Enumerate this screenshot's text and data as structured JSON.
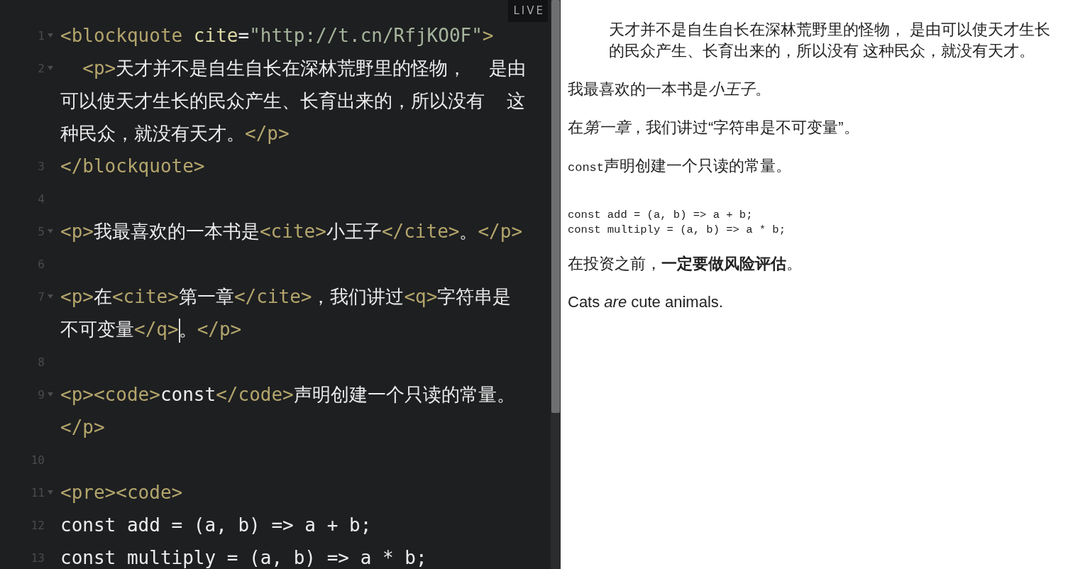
{
  "editor": {
    "live_label": "LIVE",
    "lines": [
      {
        "number": "1",
        "foldable": true,
        "tokens": [
          {
            "kind": "tag",
            "text": "<blockquote"
          },
          {
            "kind": "attr",
            "text": " cite"
          },
          {
            "kind": "text",
            "text": "="
          },
          {
            "kind": "string",
            "text": "\"http://t.cn/RfjKO0F\""
          },
          {
            "kind": "tag",
            "text": ">"
          }
        ]
      },
      {
        "number": "2",
        "foldable": true,
        "tokens": [
          {
            "kind": "tag",
            "text": "  <p>"
          },
          {
            "kind": "text",
            "text": "天才并不是自生自长在深林荒野里的怪物，  是由可以使天才生长的民众产生、长育出来的，所以没有  这种民众，就没有天才。"
          },
          {
            "kind": "tag",
            "text": "</p>"
          }
        ]
      },
      {
        "number": "3",
        "foldable": false,
        "tokens": [
          {
            "kind": "tag",
            "text": "</blockquote>"
          }
        ]
      },
      {
        "number": "4",
        "foldable": false
      },
      {
        "number": "5",
        "foldable": true,
        "tokens": [
          {
            "kind": "tag",
            "text": "<p>"
          },
          {
            "kind": "text",
            "text": "我最喜欢的一本书是"
          },
          {
            "kind": "tag",
            "text": "<cite>"
          },
          {
            "kind": "text",
            "text": "小王子"
          },
          {
            "kind": "tag",
            "text": "</cite>"
          },
          {
            "kind": "text",
            "text": "。"
          },
          {
            "kind": "tag",
            "text": "</p>"
          }
        ]
      },
      {
        "number": "6",
        "foldable": false
      },
      {
        "number": "7",
        "foldable": true,
        "tokens": [
          {
            "kind": "tag",
            "text": "<p>"
          },
          {
            "kind": "text",
            "text": "在"
          },
          {
            "kind": "tag",
            "text": "<cite>"
          },
          {
            "kind": "text",
            "text": "第一章"
          },
          {
            "kind": "tag",
            "text": "</cite>"
          },
          {
            "kind": "text",
            "text": "，我们讲过"
          },
          {
            "kind": "tag",
            "text": "<q>"
          },
          {
            "kind": "text",
            "text": "字符串是不可变量"
          },
          {
            "kind": "tag",
            "text": "</q>",
            "cursor": true
          },
          {
            "kind": "text",
            "text": "。"
          },
          {
            "kind": "tag",
            "text": "</p>"
          }
        ]
      },
      {
        "number": "8",
        "foldable": false
      },
      {
        "number": "9",
        "foldable": true,
        "tokens": [
          {
            "kind": "tag",
            "text": "<p><code>"
          },
          {
            "kind": "text",
            "text": "const"
          },
          {
            "kind": "tag",
            "text": "</code>"
          },
          {
            "kind": "text",
            "text": "声明创建一个只读的常量。"
          },
          {
            "kind": "tag",
            "text": "</p>"
          }
        ]
      },
      {
        "number": "10",
        "foldable": false
      },
      {
        "number": "11",
        "foldable": true,
        "tokens": [
          {
            "kind": "tag",
            "text": "<pre><code>"
          }
        ]
      },
      {
        "number": "12",
        "foldable": false,
        "tokens": [
          {
            "kind": "text",
            "text": "const add = (a, b) => a + b;"
          }
        ]
      },
      {
        "number": "13",
        "foldable": false,
        "tokens": [
          {
            "kind": "text",
            "text": "const multiply = (a, b) => a * b;"
          }
        ]
      }
    ]
  },
  "preview": {
    "blocks": [
      {
        "kind": "blockquote",
        "text": "天才并不是自生自长在深林荒野里的怪物， 是由可以使天才生长的民众产生、长育出来的，所以没有 这种民众，就没有天才。"
      },
      {
        "kind": "paragraph",
        "parts": [
          {
            "text": "我最喜欢的一本书是",
            "italic": false
          },
          {
            "text": "小王子",
            "italic": true
          },
          {
            "text": "。",
            "italic": false
          }
        ]
      },
      {
        "kind": "paragraph",
        "parts": [
          {
            "text": "在",
            "italic": false
          },
          {
            "text": "第一章",
            "italic": true
          },
          {
            "text": "，我们讲过“字符串是不可变量”。",
            "italic": false
          }
        ]
      },
      {
        "kind": "code_lead",
        "code": "const",
        "text": "声明创建一个只读的常量。"
      },
      {
        "kind": "pre",
        "lines": [
          "const add = (a, b) => a + b;",
          "const multiply = (a, b) => a * b;"
        ]
      },
      {
        "kind": "paragraph",
        "text": "在投资之前，**一定要做风险评估**。"
      },
      {
        "kind": "paragraph",
        "text": "Cats *are* cute animals."
      }
    ]
  }
}
